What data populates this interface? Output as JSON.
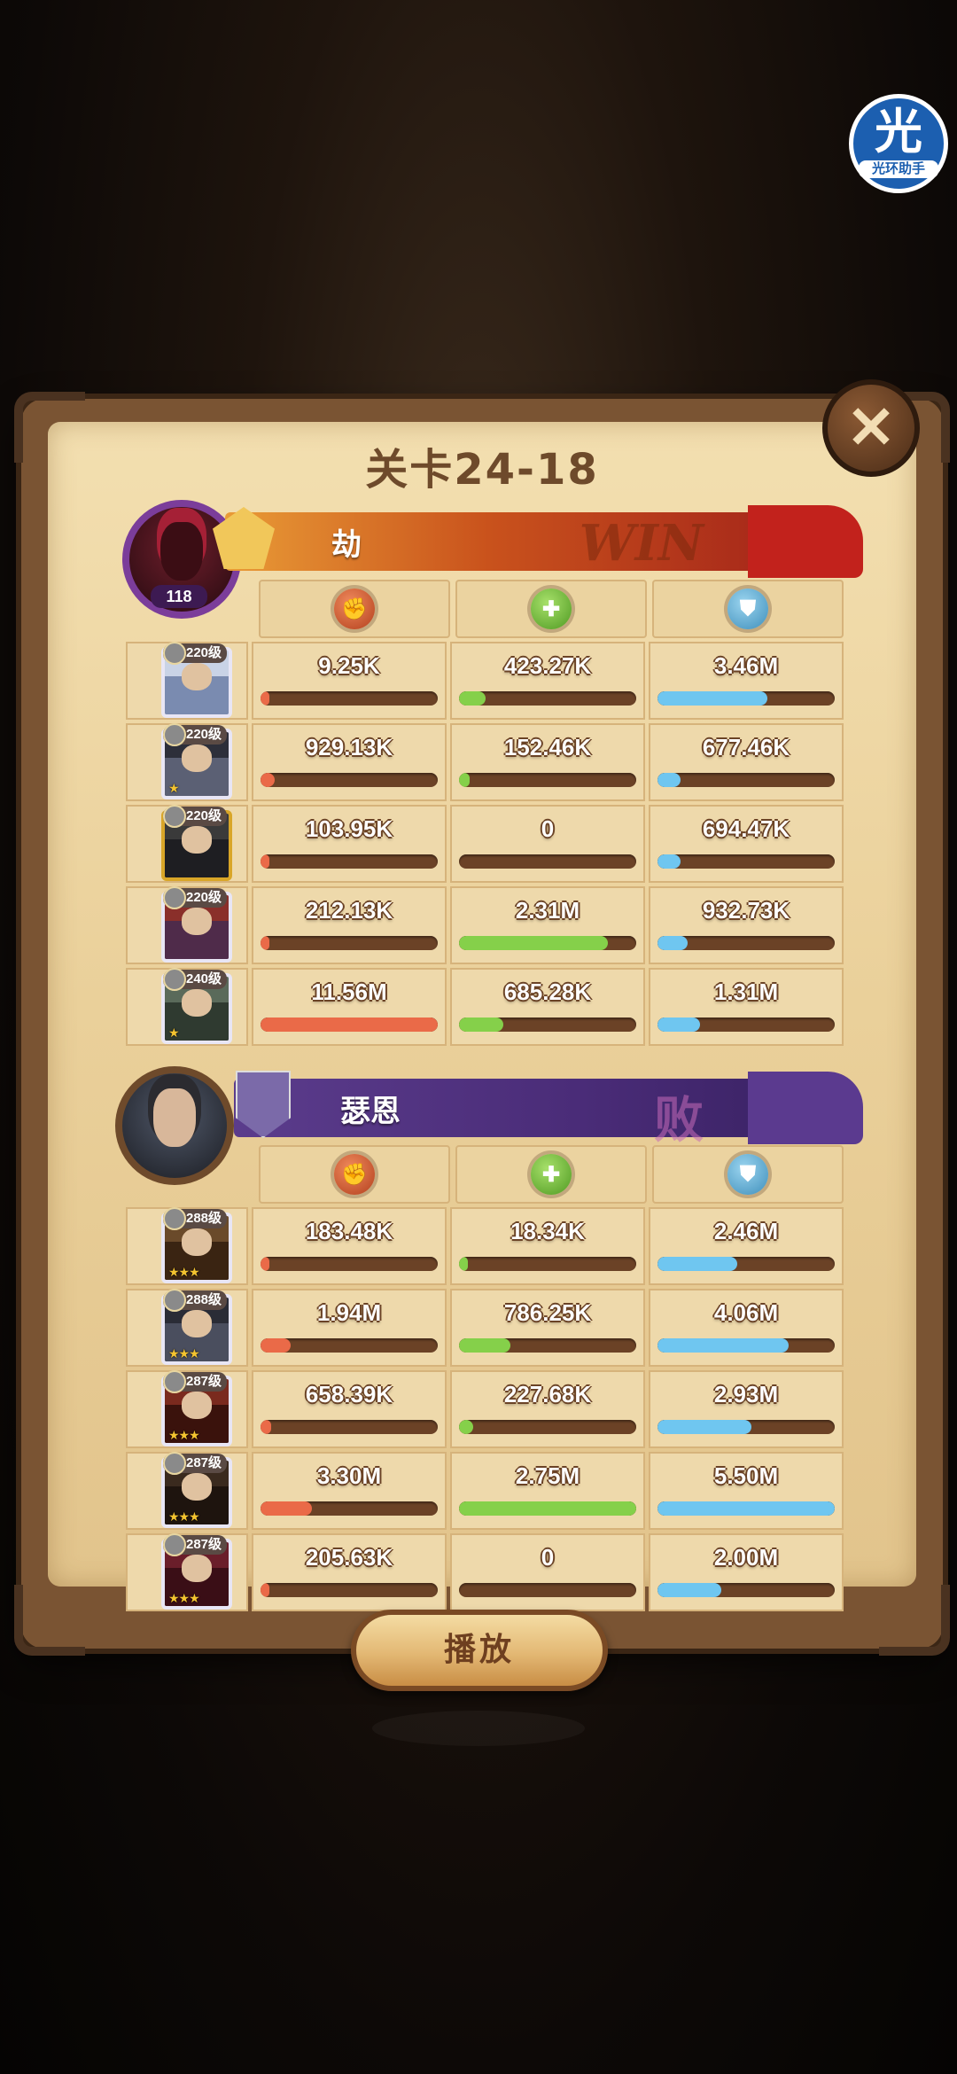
{
  "watermark": {
    "char": "光",
    "text": "光环助手"
  },
  "title": "关卡24-18",
  "close_label": "✕",
  "play_label": "播放",
  "colors": {
    "damage": "#ea6a48",
    "heal": "#85d04a",
    "shield": "#6fc6f0"
  },
  "teams": [
    {
      "player_name": "劫",
      "result": "WIN",
      "player_level": "118",
      "stat_icons": [
        "damage-icon",
        "heal-icon",
        "shield-icon"
      ],
      "heroes": [
        {
          "level": "220级",
          "stars": "",
          "damage": "9.25K",
          "heal": "423.27K",
          "shield": "3.46M",
          "damage_pct": 0.01,
          "heal_pct": 0.15,
          "shield_pct": 0.62
        },
        {
          "level": "220级",
          "stars": "★",
          "damage": "929.13K",
          "heal": "152.46K",
          "shield": "677.46K",
          "damage_pct": 0.08,
          "heal_pct": 0.06,
          "shield_pct": 0.13
        },
        {
          "level": "220级",
          "stars": "",
          "damage": "103.95K",
          "heal": "0",
          "shield": "694.47K",
          "damage_pct": 0.01,
          "heal_pct": 0,
          "shield_pct": 0.13
        },
        {
          "level": "220级",
          "stars": "",
          "damage": "212.13K",
          "heal": "2.31M",
          "shield": "932.73K",
          "damage_pct": 0.02,
          "heal_pct": 0.84,
          "shield_pct": 0.17
        },
        {
          "level": "240级",
          "stars": "★",
          "damage": "11.56M",
          "heal": "685.28K",
          "shield": "1.31M",
          "damage_pct": 1.0,
          "heal_pct": 0.25,
          "shield_pct": 0.24
        }
      ]
    },
    {
      "player_name": "瑟恩",
      "result": "败",
      "player_level": "",
      "stat_icons": [
        "damage-icon",
        "heal-icon",
        "shield-icon"
      ],
      "heroes": [
        {
          "level": "288级",
          "stars": "★★★",
          "damage": "183.48K",
          "heal": "18.34K",
          "shield": "2.46M",
          "damage_pct": 0.02,
          "heal_pct": 0.01,
          "shield_pct": 0.45
        },
        {
          "level": "288级",
          "stars": "★★★",
          "damage": "1.94M",
          "heal": "786.25K",
          "shield": "4.06M",
          "damage_pct": 0.17,
          "heal_pct": 0.29,
          "shield_pct": 0.74
        },
        {
          "level": "287级",
          "stars": "★★★",
          "damage": "658.39K",
          "heal": "227.68K",
          "shield": "2.93M",
          "damage_pct": 0.06,
          "heal_pct": 0.08,
          "shield_pct": 0.53
        },
        {
          "level": "287级",
          "stars": "★★★",
          "damage": "3.30M",
          "heal": "2.75M",
          "shield": "5.50M",
          "damage_pct": 0.29,
          "heal_pct": 1.0,
          "shield_pct": 1.0
        },
        {
          "level": "287级",
          "stars": "★★★",
          "damage": "205.63K",
          "heal": "0",
          "shield": "2.00M",
          "damage_pct": 0.02,
          "heal_pct": 0,
          "shield_pct": 0.36
        }
      ]
    }
  ]
}
